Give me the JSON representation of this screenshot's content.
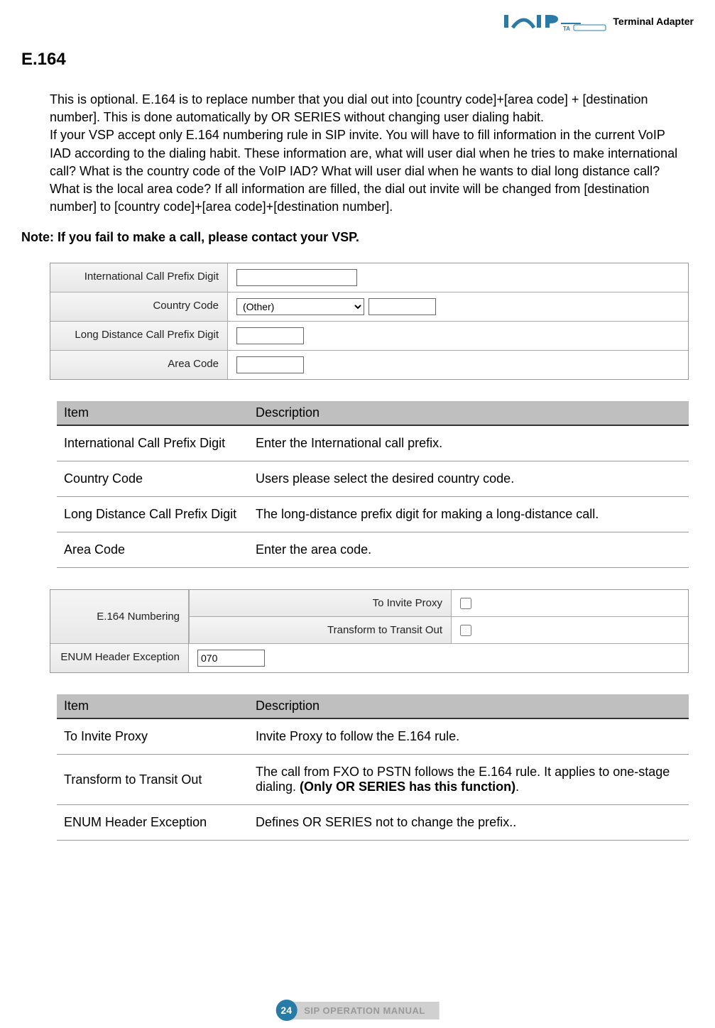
{
  "header": {
    "logo_brand": "iSIP",
    "logo_suffix": "Terminal Adapter"
  },
  "heading": "E.164",
  "para1": "This is optional. E.164 is to replace number that you dial out into [country code]+[area code] + [destination number]. This is done automatically by OR SERIES without changing user dialing habit.",
  "para2": "If your VSP accept only E.164 numbering rule in SIP invite. You will have to fill information in the current VoIP IAD according to the dialing habit. These information are, what will user dial when he tries to make international call? What is the country code of the VoIP IAD? What will user dial when he wants to dial long distance call? What is the local area code? If all information are filled, the dial out invite will be changed from [destination number] to [country code]+[area code]+[destination number].",
  "note": "Note: If you fail to make a call, please contact your VSP.",
  "form1": {
    "intl_prefix_label": "International Call Prefix Digit",
    "intl_prefix_value": "",
    "country_code_label": "Country Code",
    "country_code_value": "(Other)",
    "country_code_extra": "",
    "long_dist_label": "Long Distance Call Prefix Digit",
    "long_dist_value": "",
    "area_code_label": "Area Code",
    "area_code_value": ""
  },
  "table1": {
    "header_item": "Item",
    "header_desc": "Description",
    "rows": [
      {
        "item": "International Call Prefix Digit",
        "desc": "Enter the International call prefix."
      },
      {
        "item": "Country Code",
        "desc": "Users please select the desired country code."
      },
      {
        "item": "Long Distance Call Prefix Digit",
        "desc": "The long-distance prefix digit for making a long-distance call."
      },
      {
        "item": "Area Code",
        "desc": "Enter the area code."
      }
    ]
  },
  "form2": {
    "e164_label": "E.164 Numbering",
    "invite_proxy_label": "To Invite Proxy",
    "invite_proxy_checked": false,
    "transform_label": "Transform to Transit Out",
    "transform_checked": false,
    "enum_label": "ENUM Header Exception",
    "enum_value": "070"
  },
  "table2": {
    "header_item": "Item",
    "header_desc": "Description",
    "rows": [
      {
        "item": "To Invite Proxy",
        "desc": "Invite Proxy to follow the E.164 rule."
      },
      {
        "item": "Transform to Transit Out",
        "desc_pre": "The call from FXO to PSTN follows the E.164 rule. It applies to one-stage dialing. ",
        "desc_bold": "(Only OR SERIES has this function)",
        "desc_post": "."
      },
      {
        "item": "ENUM Header Exception",
        "desc": "Defines OR SERIES not to change the prefix.."
      }
    ]
  },
  "footer": {
    "page_number": "24",
    "manual_title": "SIP OPERATION MANUAL"
  }
}
